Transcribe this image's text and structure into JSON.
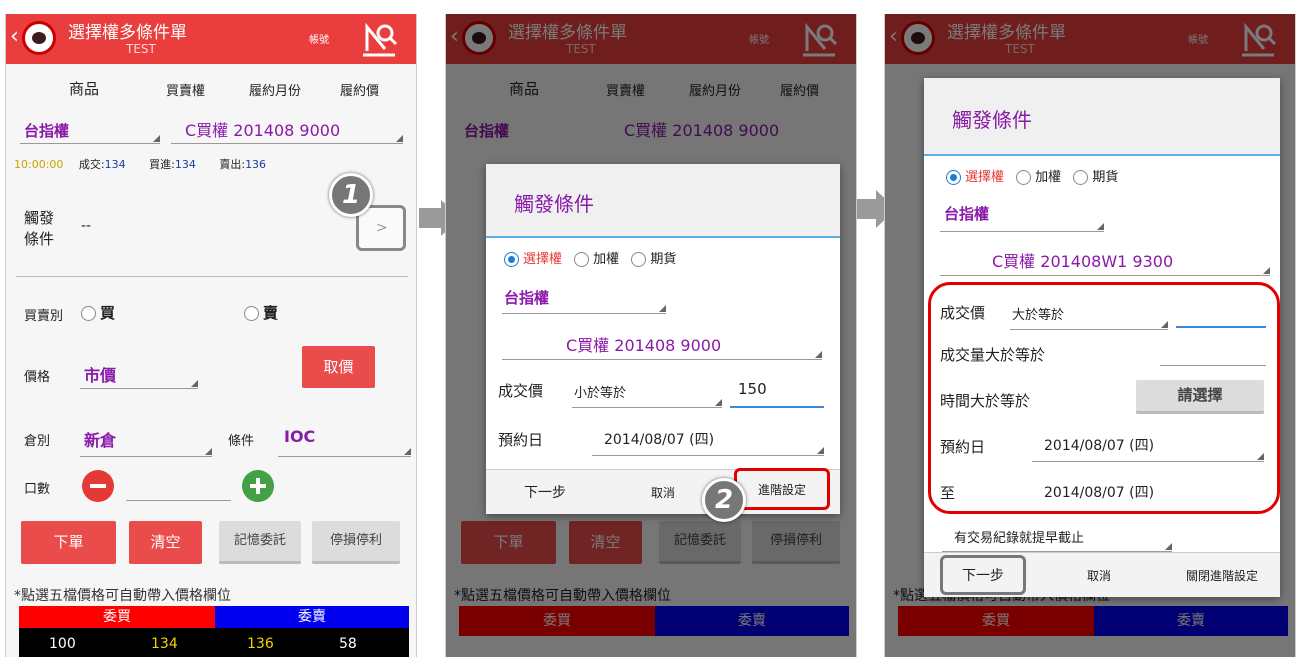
{
  "header": {
    "title": "選擇權多條件單",
    "subtitle": "TEST",
    "account": "帳號"
  },
  "panel1": {
    "col_headers": [
      "商品",
      "買賣權",
      "履約月份",
      "履約價"
    ],
    "product": "台指權",
    "contract": "C買權 201408 9000",
    "quote": {
      "time": "10:00:00",
      "trade_label": "成交:",
      "trade_value": "134",
      "bid_label": "買進:",
      "bid_value": "134",
      "ask_label": "賣出:",
      "ask_value": "136"
    },
    "trigger_label_1": "觸發",
    "trigger_label_2": "條件",
    "trigger_value": "--",
    "trigger_arrow": ">",
    "side_label": "買賣別",
    "buy": "買",
    "sell": "賣",
    "price_label": "價格",
    "price_value": "市價",
    "get_price": "取價",
    "position_label": "倉別",
    "position_value": "新倉",
    "cond_label": "條件",
    "cond_value": "IOC",
    "qty_label": "口數",
    "buttons": {
      "order": "下單",
      "clear": "清空",
      "memory": "記憶委託",
      "stop": "停損停利"
    },
    "hint": "*點選五檔價格可自動帶入價格欄位",
    "book_head": {
      "bid": "委買",
      "ask": "委賣"
    },
    "book_row": [
      "100",
      "134",
      "136",
      "58"
    ],
    "marker": "1"
  },
  "panel2": {
    "dialog_title": "觸發條件",
    "radios": [
      "選擇權",
      "加權",
      "期貨"
    ],
    "product": "台指權",
    "contract": "C買權 201408 9000",
    "price_label": "成交價",
    "price_op": "小於等於",
    "price_value": "150",
    "date_label": "預約日",
    "date_value": "2014/08/07 (四)",
    "footer": {
      "next": "下一步",
      "cancel": "取消",
      "advanced": "進階設定"
    },
    "marker": "2"
  },
  "panel3": {
    "dialog_title": "觸發條件",
    "radios": [
      "選擇權",
      "加權",
      "期貨"
    ],
    "product": "台指權",
    "contract": "C買權 201408W1 9300",
    "price_label": "成交價",
    "price_op": "大於等於",
    "vol_label": "成交量大於等於",
    "time_label": "時間大於等於",
    "time_button": "請選擇",
    "date_label": "預約日",
    "date_value": "2014/08/07 (四)",
    "to_label": "至",
    "to_value": "2014/08/07 (四)",
    "stop_option": "有交易紀錄就提早截止",
    "footer": {
      "next": "下一步",
      "cancel": "取消",
      "close_adv": "關閉進階設定"
    }
  },
  "colors": {
    "header": "#ea3d3d",
    "accent": "#8a1aa8",
    "highlight": "#e00000",
    "bid_bar": "#ff0000",
    "ask_bar": "#0000ee"
  }
}
